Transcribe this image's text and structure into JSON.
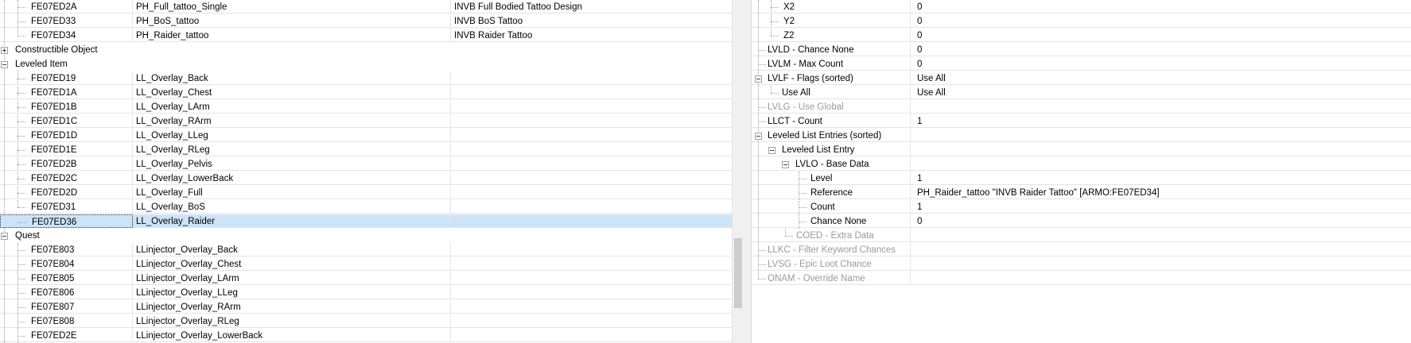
{
  "left_tree": {
    "top_rows": [
      {
        "id": "FE07ED2A",
        "editor_id": "PH_Full_tattoo_Single",
        "name": "INVB Full Bodied Tattoo Design"
      },
      {
        "id": "FE07ED33",
        "editor_id": "PH_BoS_tattoo",
        "name": "INVB BoS Tattoo"
      },
      {
        "id": "FE07ED34",
        "editor_id": "PH_Raider_tattoo",
        "name": "INVB Raider Tattoo"
      }
    ],
    "constructible": {
      "label": "Constructible Object"
    },
    "leveled_item": {
      "label": "Leveled Item",
      "rows": [
        {
          "id": "FE07ED19",
          "editor_id": "LL_Overlay_Back"
        },
        {
          "id": "FE07ED1A",
          "editor_id": "LL_Overlay_Chest"
        },
        {
          "id": "FE07ED1B",
          "editor_id": "LL_Overlay_LArm"
        },
        {
          "id": "FE07ED1C",
          "editor_id": "LL_Overlay_RArm"
        },
        {
          "id": "FE07ED1D",
          "editor_id": "LL_Overlay_LLeg"
        },
        {
          "id": "FE07ED1E",
          "editor_id": "LL_Overlay_RLeg"
        },
        {
          "id": "FE07ED2B",
          "editor_id": "LL_Overlay_Pelvis"
        },
        {
          "id": "FE07ED2C",
          "editor_id": "LL_Overlay_LowerBack"
        },
        {
          "id": "FE07ED2D",
          "editor_id": "LL_Overlay_Full"
        },
        {
          "id": "FE07ED31",
          "editor_id": "LL_Overlay_BoS"
        },
        {
          "id": "FE07ED36",
          "editor_id": "LL_Overlay_Raider"
        }
      ]
    },
    "quest": {
      "label": "Quest",
      "rows": [
        {
          "id": "FE07E803",
          "editor_id": "LLinjector_Overlay_Back"
        },
        {
          "id": "FE07E804",
          "editor_id": "LLinjector_Overlay_Chest"
        },
        {
          "id": "FE07E805",
          "editor_id": "LLinjector_Overlay_LArm"
        },
        {
          "id": "FE07E806",
          "editor_id": "LLinjector_Overlay_LLeg"
        },
        {
          "id": "FE07E807",
          "editor_id": "LLinjector_Overlay_RArm"
        },
        {
          "id": "FE07E808",
          "editor_id": "LLinjector_Overlay_RLeg"
        },
        {
          "id": "FE07ED2E",
          "editor_id": "LLinjector_Overlay_LowerBack"
        }
      ]
    }
  },
  "record_view": {
    "x2": {
      "label": "X2",
      "value": "0"
    },
    "y2": {
      "label": "Y2",
      "value": "0"
    },
    "z2": {
      "label": "Z2",
      "value": "0"
    },
    "lvld": {
      "label": "LVLD - Chance None",
      "value": "0"
    },
    "lvlm": {
      "label": "LVLM - Max Count",
      "value": "0"
    },
    "lvlf": {
      "label": "LVLF - Flags (sorted)",
      "value": "Use All"
    },
    "use_all": {
      "label": "Use All",
      "value": "Use All"
    },
    "lvlg": {
      "label": "LVLG - Use Global"
    },
    "llct": {
      "label": "LLCT - Count",
      "value": "1"
    },
    "entries": {
      "label": "Leveled List Entries (sorted)"
    },
    "entry": {
      "label": "Leveled List Entry"
    },
    "lvlo": {
      "label": "LVLO - Base Data"
    },
    "level": {
      "label": "Level",
      "value": "1"
    },
    "reference": {
      "label": "Reference",
      "value": "PH_Raider_tattoo \"INVB Raider Tattoo\" [ARMO:FE07ED34]"
    },
    "count": {
      "label": "Count",
      "value": "1"
    },
    "chance_none": {
      "label": "Chance None",
      "value": "0"
    },
    "coed": {
      "label": "COED - Extra Data"
    },
    "llkc": {
      "label": "LLKC - Filter Keyword Chances"
    },
    "lvsg": {
      "label": "LVSG - Epic Loot Chance"
    },
    "onam": {
      "label": "ONAM - Override Name"
    }
  }
}
